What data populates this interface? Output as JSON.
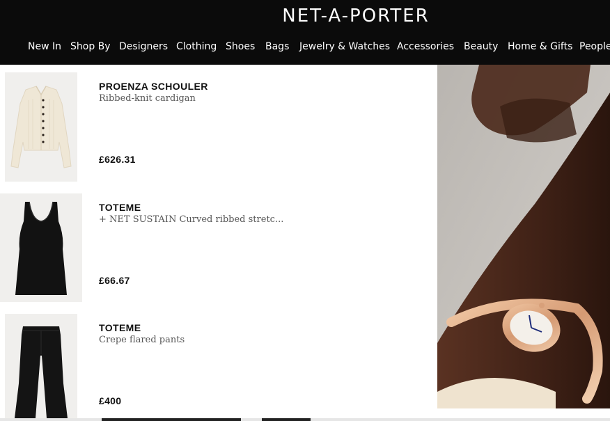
{
  "header": {
    "logo": "NET-A-PORTER",
    "nav": [
      "New In",
      "Shop By",
      "Designers",
      "Clothing",
      "Shoes",
      "Bags",
      "Jewelry & Watches",
      "Accessories",
      "Beauty",
      "Home & Gifts",
      "People"
    ]
  },
  "products": [
    {
      "brand": "PROENZA SCHOULER",
      "name": "Ribbed-knit cardigan",
      "price": "£626.31"
    },
    {
      "brand": "TOTEME",
      "name": "+ NET SUSTAIN Curved ribbed stretc...",
      "price": "£66.67"
    },
    {
      "brand": "TOTEME",
      "name": "Crepe flared pants",
      "price": "£400"
    }
  ],
  "colors": {
    "header_bg": "#0b0b0b",
    "text": "#111111",
    "muted": "#555555"
  }
}
